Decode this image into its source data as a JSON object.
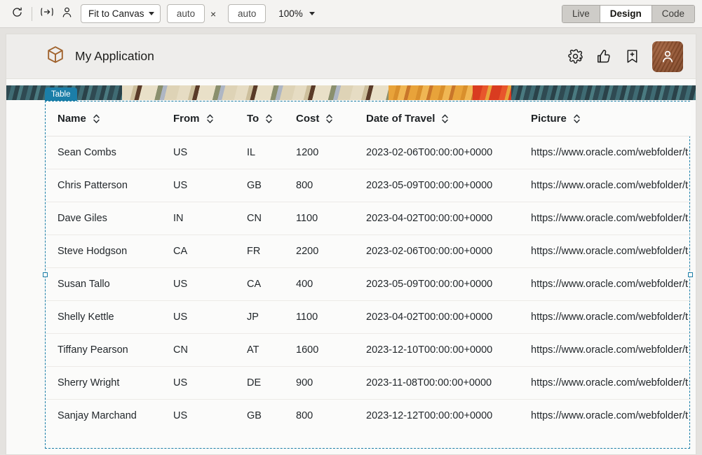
{
  "toolbar": {
    "refresh_icon": "refresh-icon",
    "width_icon": "fit-width-icon",
    "person_icon": "person-icon",
    "fit_select": {
      "value": "Fit to Canvas"
    },
    "width_input": {
      "value": "auto",
      "placeholder": "auto"
    },
    "times_symbol": "×",
    "height_input": {
      "value": "auto",
      "placeholder": "auto"
    },
    "zoom": {
      "value": "100%"
    },
    "modes": [
      {
        "label": "Live",
        "active": false
      },
      {
        "label": "Design",
        "active": true
      },
      {
        "label": "Code",
        "active": false
      }
    ]
  },
  "app": {
    "logo_icon": "cube-icon",
    "title": "My Application",
    "actions": [
      {
        "name": "gear-icon"
      },
      {
        "name": "thumbs-up-icon"
      },
      {
        "name": "bookmark-add-icon"
      },
      {
        "name": "avatar"
      }
    ],
    "accent_color": "#8d4f2d"
  },
  "selection": {
    "badge_label": "Table",
    "badge_color": "#1b7ea8"
  },
  "table": {
    "columns": [
      {
        "label": "Name",
        "key": "name",
        "sortable": true
      },
      {
        "label": "From",
        "key": "from",
        "sortable": true
      },
      {
        "label": "To",
        "key": "to",
        "sortable": true
      },
      {
        "label": "Cost",
        "key": "cost",
        "sortable": true
      },
      {
        "label": "Date of Travel",
        "key": "date",
        "sortable": true
      },
      {
        "label": "Picture",
        "key": "picture",
        "sortable": true
      }
    ],
    "rows": [
      {
        "name": "Sean Combs",
        "from": "US",
        "to": "IL",
        "cost": "1200",
        "date": "2023-02-06T00:00:00+0000",
        "picture": "https://www.oracle.com/webfolder/t"
      },
      {
        "name": "Chris Patterson",
        "from": "US",
        "to": "GB",
        "cost": "800",
        "date": "2023-05-09T00:00:00+0000",
        "picture": "https://www.oracle.com/webfolder/t"
      },
      {
        "name": "Dave Giles",
        "from": "IN",
        "to": "CN",
        "cost": "1100",
        "date": "2023-04-02T00:00:00+0000",
        "picture": "https://www.oracle.com/webfolder/t"
      },
      {
        "name": "Steve Hodgson",
        "from": "CA",
        "to": "FR",
        "cost": "2200",
        "date": "2023-02-06T00:00:00+0000",
        "picture": "https://www.oracle.com/webfolder/t"
      },
      {
        "name": "Susan Tallo",
        "from": "US",
        "to": "CA",
        "cost": "400",
        "date": "2023-05-09T00:00:00+0000",
        "picture": "https://www.oracle.com/webfolder/t"
      },
      {
        "name": "Shelly Kettle",
        "from": "US",
        "to": "JP",
        "cost": "1100",
        "date": "2023-04-02T00:00:00+0000",
        "picture": "https://www.oracle.com/webfolder/t"
      },
      {
        "name": "Tiffany Pearson",
        "from": "CN",
        "to": "AT",
        "cost": "1600",
        "date": "2023-12-10T00:00:00+0000",
        "picture": "https://www.oracle.com/webfolder/t"
      },
      {
        "name": "Sherry Wright",
        "from": "US",
        "to": "DE",
        "cost": "900",
        "date": "2023-11-08T00:00:00+0000",
        "picture": "https://www.oracle.com/webfolder/t"
      },
      {
        "name": "Sanjay Marchand",
        "from": "US",
        "to": "GB",
        "cost": "800",
        "date": "2023-12-12T00:00:00+0000",
        "picture": "https://www.oracle.com/webfolder/t"
      }
    ]
  }
}
